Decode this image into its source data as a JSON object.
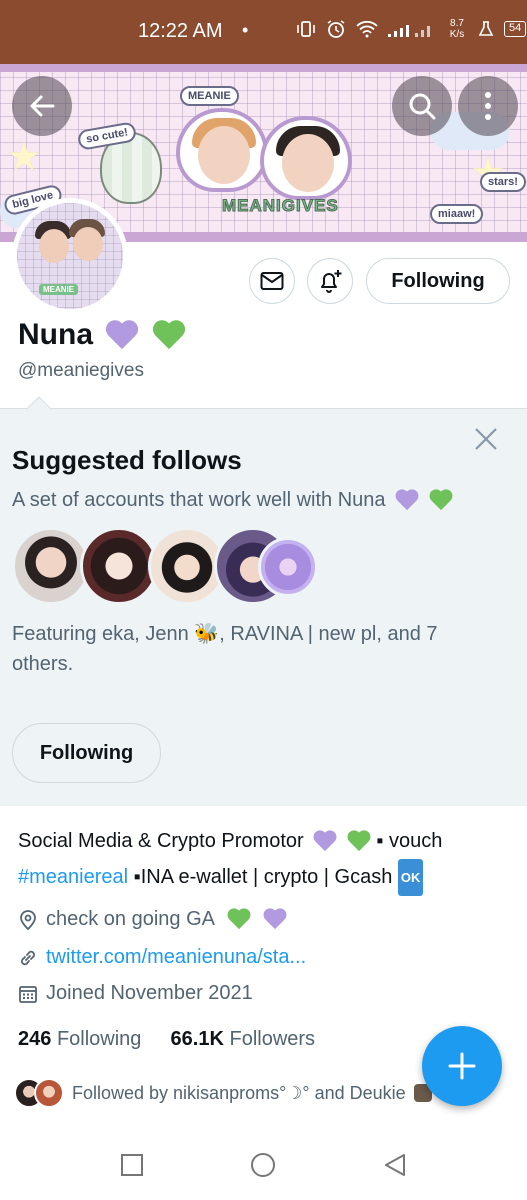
{
  "status_bar": {
    "time": "12:22 AM",
    "dot": "•",
    "net_speed_value": "8.7",
    "net_speed_unit": "K/s",
    "battery": "54"
  },
  "header": {
    "back_icon": "arrow-left-icon",
    "search_icon": "search-icon",
    "more_icon": "more-vertical-icon"
  },
  "banner": {
    "stickers": [
      "MEANIE",
      "so cute!",
      "big love",
      "stars!",
      "miaaw!"
    ],
    "brand": "MEANIGIVES"
  },
  "profile": {
    "avatar_label": "MEANIE",
    "display_name": "Nuna",
    "handle": "@meaniegives",
    "following_button": "Following",
    "message_icon": "envelope-icon",
    "notify_icon": "bell-plus-icon"
  },
  "suggested": {
    "title": "Suggested follows",
    "subtitle": "A set of accounts that work well with Nuna",
    "featuring_part1": "Featuring eka, Jenn",
    "featuring_part2": ", RAVINA | new pl, and 7 others.",
    "bee": "🐝",
    "follow_button": "Following",
    "avatar_colors": [
      "#d9d2cf",
      "#2b1b1b",
      "#f1e2d8",
      "#3a2d55",
      "#a78ce0"
    ]
  },
  "bio": {
    "line1": "Social Media & Crypto Promotor",
    "line1_tail": "▪ vouch",
    "hashtag": "#meaniereal",
    "line2_tail": "▪INA e-wallet | crypto | Gcash",
    "ok": "OK"
  },
  "meta": {
    "location": "check on going GA",
    "url": "twitter.com/meanienuna/sta...",
    "joined": "Joined November 2021"
  },
  "counts": {
    "following_count": "246",
    "following_label": "Following",
    "followers_count": "66.1K",
    "followers_label": "Followers"
  },
  "followed_by": {
    "text": "Followed by nikisanproms°☽° and Deukie"
  },
  "fab": {
    "icon": "plus-icon"
  },
  "nav": {
    "icons": [
      "recent-apps-icon",
      "home-icon",
      "back-icon"
    ]
  }
}
